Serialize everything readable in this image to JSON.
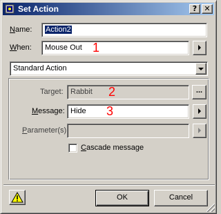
{
  "window": {
    "title": "Set Action"
  },
  "titlebar": {
    "help_glyph": "?",
    "close_glyph": "✕"
  },
  "form": {
    "name_label": "Name:",
    "name_value": "Action2",
    "when_label": "When:",
    "when_value": "Mouse Out",
    "action_type_value": "Standard Action",
    "target_label": "Target:",
    "target_value": "Rabbit",
    "target_browse": "...",
    "message_label": "Message:",
    "message_value": "Hide",
    "parameters_label": "Parameter(s):",
    "parameters_value": "",
    "cascade_label": "Cascade message",
    "cascade_checked": false
  },
  "annotations": {
    "n1": "1",
    "n2": "2",
    "n3": "3"
  },
  "buttons": {
    "ok": "OK",
    "cancel": "Cancel"
  },
  "colors": {
    "title_start": "#0a246a",
    "title_end": "#a6caf0",
    "annotation": "#ff0000",
    "face": "#d4d0c8"
  }
}
